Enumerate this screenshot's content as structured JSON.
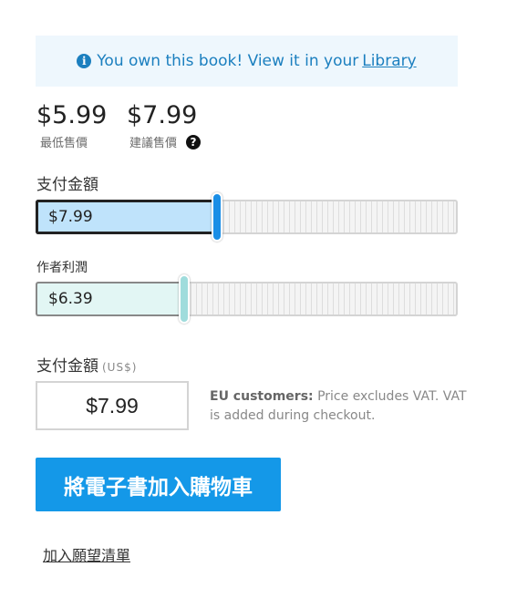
{
  "notice": {
    "icon": "info-icon",
    "text": "You own this book!  View it in your",
    "link_label": "Library"
  },
  "prices": {
    "minimum_value": "$5.99",
    "minimum_caption": "最低售價",
    "suggested_value": "$7.99",
    "suggested_caption": "建議售價",
    "help_icon": "question-circle-icon"
  },
  "payment_slider": {
    "label": "支付金額",
    "value": "$7.99",
    "level_fraction": 0.43,
    "fill_color": "#bfe3fb",
    "handle_color": "#1a8ee6"
  },
  "royalty_slider": {
    "label": "作者利潤",
    "value": "$6.39",
    "level_fraction": 0.35,
    "fill_color": "#e2f6f4",
    "handle_color": "#9fdcdc"
  },
  "amount": {
    "label": "支付金額",
    "unit": "(US$)",
    "value": "$7.99"
  },
  "vat": {
    "bold": "EU customers:",
    "text": " Price excludes VAT. VAT is added during checkout."
  },
  "actions": {
    "add_to_cart": "將電子書加入購物車",
    "add_to_wishlist": "加入願望清單",
    "button_color": "#1498e8"
  }
}
